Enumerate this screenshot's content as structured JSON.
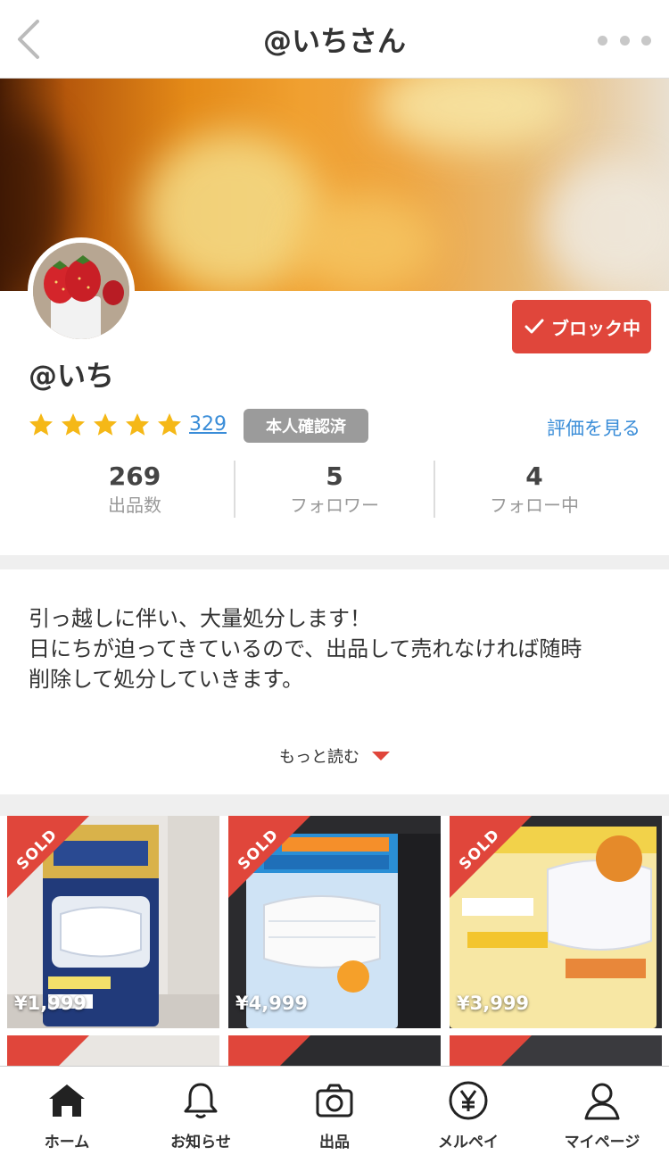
{
  "header": {
    "title": "@いちさん"
  },
  "profile": {
    "username": "@いち",
    "block_label": "ブロック中",
    "rating_count": "329",
    "verified_label": "本人確認済",
    "see_reviews_label": "評価を見る",
    "rating_stars": 5
  },
  "stats": [
    {
      "value": "269",
      "label": "出品数"
    },
    {
      "value": "5",
      "label": "フォロワー"
    },
    {
      "value": "4",
      "label": "フォロー中"
    }
  ],
  "intro": {
    "lines": [
      "引っ越しに伴い、大量処分します！",
      "日にちが迫ってきているので、出品して売れなければ随時",
      "削除して処分していきます。"
    ],
    "read_more": "もっと読む"
  },
  "products": [
    {
      "status": "SOLD",
      "price": "¥1,999"
    },
    {
      "status": "SOLD",
      "price": "¥4,999"
    },
    {
      "status": "SOLD",
      "price": "¥3,999"
    }
  ],
  "nav": [
    {
      "label": "ホーム",
      "icon": "home-icon"
    },
    {
      "label": "お知らせ",
      "icon": "bell-icon"
    },
    {
      "label": "出品",
      "icon": "camera-icon"
    },
    {
      "label": "メルペイ",
      "icon": "yen-icon"
    },
    {
      "label": "マイページ",
      "icon": "person-icon"
    }
  ],
  "colors": {
    "accent": "#e0463b",
    "link": "#3a8dd8",
    "star": "#f5b817",
    "badge": "#9b9b9b"
  }
}
